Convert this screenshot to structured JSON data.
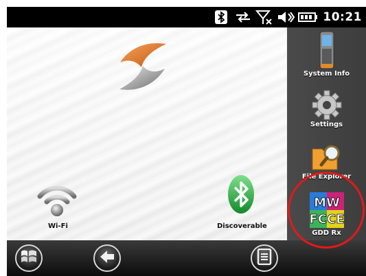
{
  "status_bar": {
    "icons": [
      "bluetooth-icon",
      "sync-arrows-icon",
      "no-signal-icon",
      "volume-icon",
      "battery-icon"
    ],
    "time": "10:21"
  },
  "desktop": {
    "logo": "brand-logo",
    "items": [
      {
        "label": "Wi-Fi",
        "icon": "wifi-icon"
      },
      {
        "label": "Discoverable",
        "icon": "bluetooth-icon"
      }
    ]
  },
  "side_panel": {
    "items": [
      {
        "label": "System Info",
        "icon": "device-icon"
      },
      {
        "label": "Settings",
        "icon": "gear-icon"
      },
      {
        "label": "File Explorer",
        "icon": "folder-search-icon"
      },
      {
        "label": "GDD Rx",
        "icon": "app-icon"
      }
    ]
  },
  "taskbar": {
    "buttons": [
      "start-icon",
      "back-icon",
      "menu-icon"
    ]
  },
  "colors": {
    "highlight": "#e21a1a",
    "bluetooth_green": "#2db84a",
    "panel": "#444444"
  }
}
